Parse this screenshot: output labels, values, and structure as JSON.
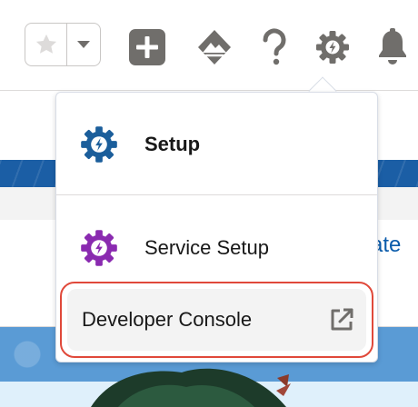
{
  "header": {
    "favorites": {
      "star_icon": "star-icon",
      "dropdown_icon": "caret-down-icon"
    },
    "icons": [
      "add-icon",
      "trailhead-icon",
      "help-icon",
      "gear-icon",
      "bell-icon"
    ]
  },
  "background": {
    "link_fragment": "ate"
  },
  "menu": {
    "items": [
      {
        "label": "Setup",
        "icon": "gear-bolt-icon",
        "icon_color": "#1b5e9b"
      },
      {
        "label": "Service Setup",
        "icon": "gear-bolt-icon",
        "icon_color": "#8a2ab0"
      }
    ],
    "developer_console": {
      "label": "Developer Console",
      "icon": "external-link-icon",
      "highlight_color": "#e0493a"
    }
  },
  "colors": {
    "icon_gray": "#706e6b",
    "setup_blue": "#1b5e9b",
    "service_purple": "#8a2ab0"
  }
}
